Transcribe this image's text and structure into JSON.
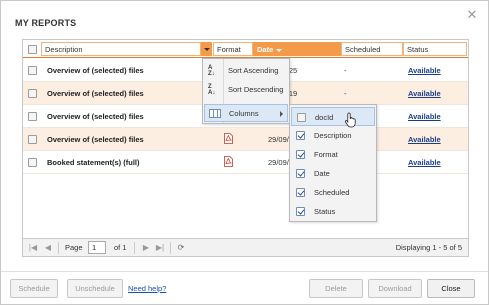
{
  "dialog": {
    "title": "MY REPORTS"
  },
  "grid": {
    "columns": [
      "Description",
      "Format",
      "Date",
      "Scheduled",
      "Status"
    ],
    "rows": [
      {
        "description": "Overview of (selected) files",
        "date": "16:23:25",
        "scheduled": "-",
        "status": "Available",
        "format_icon": "pdf-icon"
      },
      {
        "description": "Overview of (selected) files",
        "date": "16:16:19",
        "scheduled": "-",
        "status": "Available",
        "format_icon": "pdf-icon"
      },
      {
        "description": "Overview of (selected) files",
        "date": "",
        "scheduled": "",
        "status": "Available",
        "format_icon": "pdf-icon"
      },
      {
        "description": "Overview of (selected) files",
        "date": "29/09/14",
        "scheduled": "",
        "status": "Available",
        "format_icon": "pdf-icon"
      },
      {
        "description": "Booked statement(s) (full)",
        "date": "29/09/14",
        "scheduled": "",
        "status": "Available",
        "format_icon": "pdf-icon"
      }
    ]
  },
  "column_menu": {
    "items": [
      "Sort Ascending",
      "Sort Descending",
      "Columns"
    ],
    "icons": [
      "sort-ascending-icon",
      "sort-descending-icon",
      "columns-icon"
    ]
  },
  "columns_submenu": {
    "items": [
      {
        "label": "docId",
        "checked": false
      },
      {
        "label": "Description",
        "checked": true
      },
      {
        "label": "Format",
        "checked": true
      },
      {
        "label": "Date",
        "checked": true
      },
      {
        "label": "Scheduled",
        "checked": true
      },
      {
        "label": "Status",
        "checked": true
      }
    ]
  },
  "pager": {
    "page_label": "Page",
    "page_value": "1",
    "of_label": "of 1",
    "displaying": "Displaying 1 - 5 of 5"
  },
  "footer": {
    "schedule": "Schedule",
    "unschedule": "Unschedule",
    "help": "Need help?",
    "delete": "Delete",
    "download": "Download",
    "close": "Close"
  },
  "colors": {
    "accent": "#f39b4a",
    "row_alt": "#fdeee2",
    "link": "#1a3e8a"
  }
}
